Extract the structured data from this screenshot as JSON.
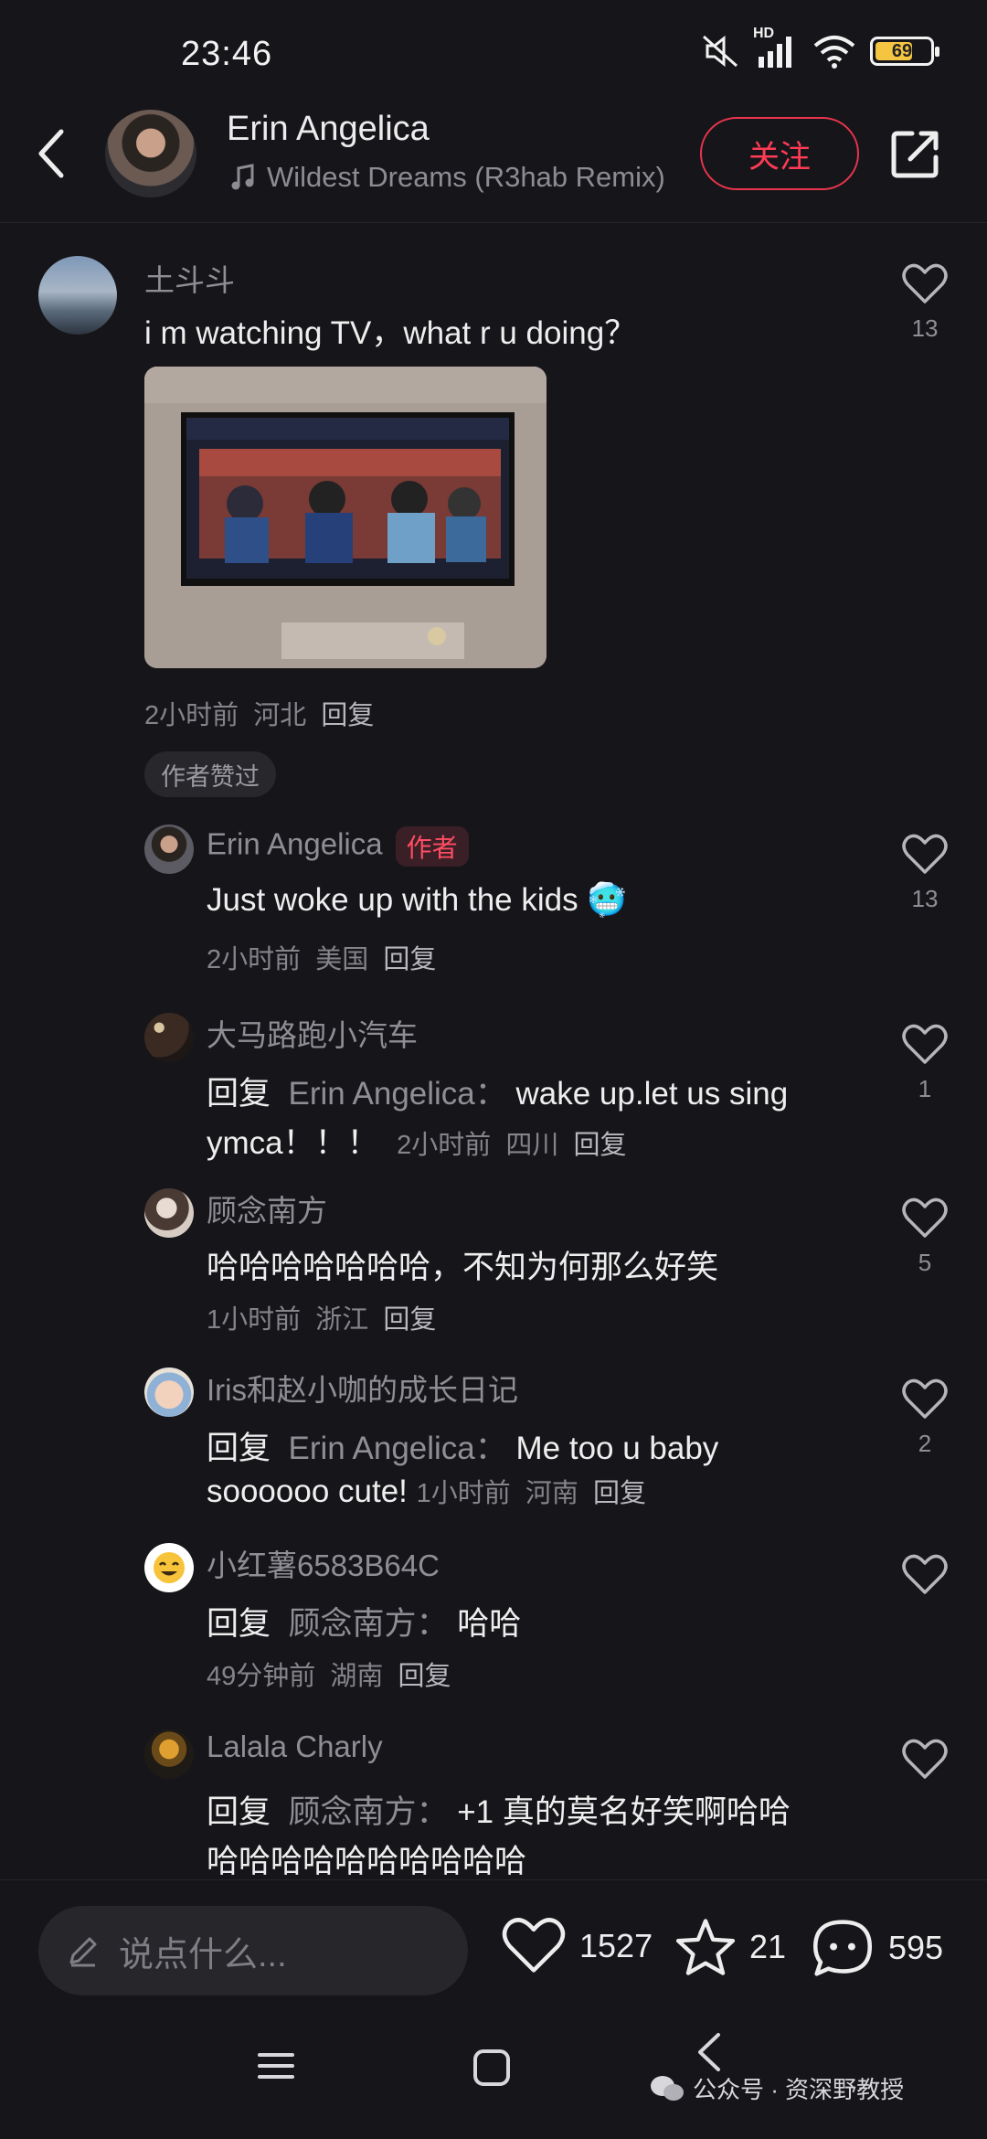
{
  "status_bar": {
    "time": "23:46",
    "network_label": "HD",
    "battery_level": "69",
    "battery_color": "#f5c542",
    "icons": [
      "mute-icon",
      "signal-icon",
      "wifi-icon",
      "battery-icon"
    ]
  },
  "header": {
    "author_name": "Erin Angelica",
    "song": "Wildest Dreams (R3hab Remix)",
    "follow_label": "关注",
    "accent_color": "#ff3b55"
  },
  "comments": [
    {
      "user": "土斗斗",
      "text": "i m watching TV，what r u doing？",
      "has_image": true,
      "meta_time": "2小时前",
      "meta_location": "河北",
      "reply_label": "回复",
      "likes": "13",
      "badge": "作者赞过"
    },
    {
      "user": "Erin Angelica",
      "author_tag": "作者",
      "text": "Just woke up with the kids 🥶",
      "meta_time": "2小时前",
      "meta_location": "美国",
      "reply_label": "回复",
      "likes": "13"
    },
    {
      "user": "大马路跑小汽车",
      "reply_prefix": "回复",
      "reply_target": "Erin Angelica：",
      "text_line1": "wake up.let us sing",
      "text_line2": "ymca！！！",
      "meta_time": "2小时前",
      "meta_location": "四川",
      "reply_label": "回复",
      "likes": "1"
    },
    {
      "user": "顾念南方",
      "text": "哈哈哈哈哈哈哈，不知为何那么好笑",
      "meta_time": "1小时前",
      "meta_location": "浙江",
      "reply_label": "回复",
      "likes": "5"
    },
    {
      "user": "Iris和赵小咖的成长日记",
      "reply_prefix": "回复",
      "reply_target": "Erin Angelica：",
      "text_line1": "Me too u baby",
      "text_line2": "soooooo cute!",
      "meta_time": "1小时前",
      "meta_location": "河南",
      "reply_label": "回复",
      "likes": "2"
    },
    {
      "user": "小红薯6583B64C",
      "reply_prefix": "回复",
      "reply_target": "顾念南方：",
      "text": "哈哈",
      "meta_time": "49分钟前",
      "meta_location": "湖南",
      "reply_label": "回复",
      "likes": ""
    },
    {
      "user": "Lalala Charly",
      "reply_prefix": "回复",
      "reply_target": "顾念南方：",
      "text_line1": "+1 真的莫名好笑啊哈哈",
      "text_line2": "哈哈哈哈哈哈哈哈哈哈",
      "likes": ""
    }
  ],
  "bottom_bar": {
    "input_placeholder": "说点什么...",
    "like_count": "1527",
    "collect_count": "21",
    "comment_count": "595"
  },
  "watermark": {
    "text": "公众号 · 资深野教授"
  }
}
